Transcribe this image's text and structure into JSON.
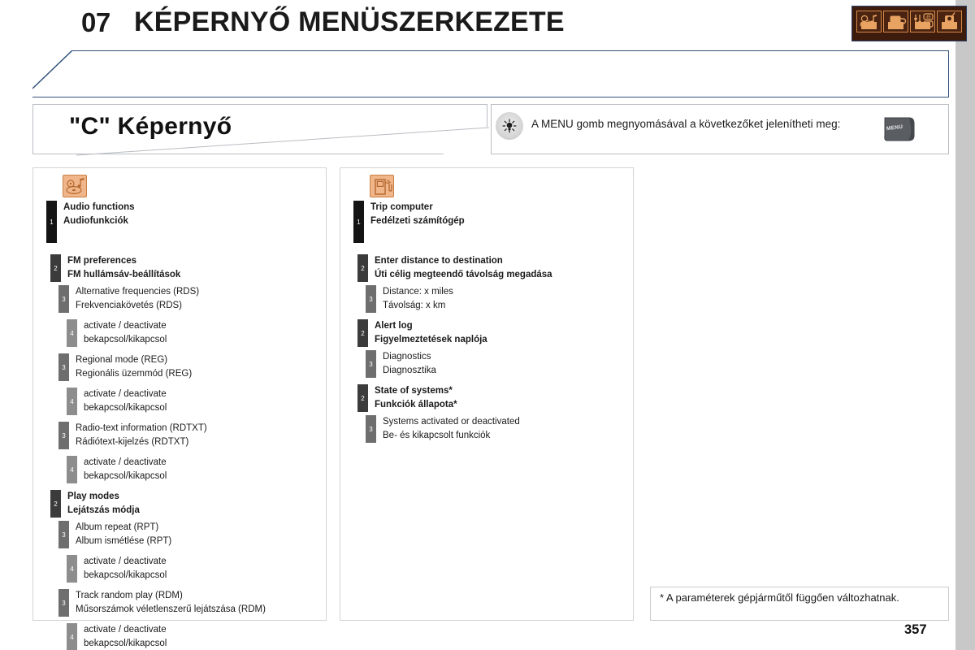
{
  "header": {
    "chapter_number": "07",
    "chapter_title": "KÉPERNYŐ MENÜSZERKEZETE",
    "icon_strip_name": "audio-system-icon-strip",
    "strip_icons": [
      "media-disc-music-icon",
      "beverage-cup-icon",
      "equalizer-db-icon",
      "radio-handset-icon"
    ],
    "title_border_color": "#32517a",
    "strip_background_color": "#3d1c0d",
    "strip_icon_color": "#e8a262"
  },
  "screen_banner": {
    "title": "\"C\" Képernyő"
  },
  "note": {
    "icon": "light-bulb-tip-icon",
    "text": "A MENU gomb megnyomásával a következőket jelenítheti meg:",
    "key_label": "MENU",
    "key_icon": "menu-button-icon"
  },
  "columns": [
    {
      "id": "audio-column",
      "icon": "audio-functions-icon",
      "nodes": [
        {
          "level": 1,
          "en": "Audio functions",
          "hu": "Audiofunkciók",
          "gap": ""
        },
        {
          "level": 2,
          "en": "FM preferences",
          "hu": "FM hullámsáv-beállítások",
          "gap": "gap-lg"
        },
        {
          "level": 3,
          "en": "Alternative frequencies (RDS)",
          "hu": "Frekvenciakövetés (RDS)",
          "gap": "gap-sm"
        },
        {
          "level": 4,
          "en": "activate / deactivate",
          "hu": "bekapcsol/kikapcsol",
          "gap": "gap-md"
        },
        {
          "level": 3,
          "en": "Regional mode (REG)",
          "hu": "Regionális üzemmód (REG)",
          "gap": "gap-md"
        },
        {
          "level": 4,
          "en": "activate / deactivate",
          "hu": "bekapcsol/kikapcsol",
          "gap": "gap-md"
        },
        {
          "level": 3,
          "en": "Radio-text information (RDTXT)",
          "hu": "Rádiótext-kijelzés (RDTXT)",
          "gap": "gap-md"
        },
        {
          "level": 4,
          "en": "activate / deactivate",
          "hu": "bekapcsol/kikapcsol",
          "gap": "gap-md"
        },
        {
          "level": 2,
          "en": "Play modes",
          "hu": "Lejátszás módja",
          "gap": "gap-md"
        },
        {
          "level": 3,
          "en": "Album repeat (RPT)",
          "hu": "Album ismétlése (RPT)",
          "gap": "gap-sm"
        },
        {
          "level": 4,
          "en": "activate / deactivate",
          "hu": "bekapcsol/kikapcsol",
          "gap": "gap-md"
        },
        {
          "level": 3,
          "en": "Track random play (RDM)",
          "hu": "Műsorszámok véletlenszerű lejátszása (RDM)",
          "gap": "gap-md"
        },
        {
          "level": 4,
          "en": "activate / deactivate",
          "hu": "bekapcsol/kikapcsol",
          "gap": "gap-md"
        }
      ]
    },
    {
      "id": "trip-computer-column",
      "icon": "fuel-pump-icon",
      "nodes": [
        {
          "level": 1,
          "en": "Trip computer",
          "hu": "Fedélzeti számítógép",
          "gap": ""
        },
        {
          "level": 2,
          "en": "Enter distance to destination",
          "hu": "Úti célig megteendő távolság megadása",
          "gap": "gap-lg"
        },
        {
          "level": 3,
          "en": "Distance: x miles",
          "hu": "Távolság: x km",
          "gap": "gap-sm"
        },
        {
          "level": 2,
          "en": "Alert log",
          "hu": "Figyelmeztetések naplója",
          "gap": "gap-md"
        },
        {
          "level": 3,
          "en": "Diagnostics",
          "hu": "Diagnosztika",
          "gap": "gap-sm"
        },
        {
          "level": 2,
          "en": "State of systems*",
          "hu": "Funkciók állapota*",
          "gap": "gap-md"
        },
        {
          "level": 3,
          "en": "Systems activated or deactivated",
          "hu": "Be- és kikapcsolt funkciók",
          "gap": "gap-sm"
        }
      ]
    }
  ],
  "footnote": {
    "text": "* A paraméterek gépjárműtől függően változhatnak."
  },
  "page_number": "357"
}
